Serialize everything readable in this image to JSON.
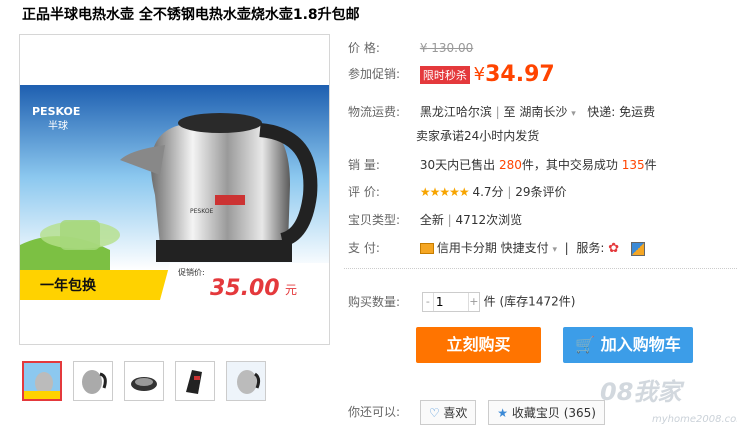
{
  "product": {
    "title": "正品半球电热水壶 全不锈钢电热水壶烧水壶1.8升包邮",
    "image": {
      "brand": "PESKOE",
      "brand_sub": "半球",
      "badge": "一年包换",
      "promo_label": "促销价:",
      "promo_price": "35.00",
      "promo_unit": "元",
      "kettle_label": "PESKOE"
    }
  },
  "price": {
    "label": "价      格:",
    "original": "¥ 130.00",
    "promo_label": "参加促销:",
    "limited_tag": "限时秒杀",
    "currency": "¥",
    "current": "34.97"
  },
  "shipping": {
    "label": "物流运费:",
    "from": "黑龙江哈尔滨",
    "sep": "|",
    "to_prefix": "至",
    "to": "湖南长沙",
    "express": "快递: 免运费",
    "promise": "卖家承诺24小时内发货"
  },
  "sales": {
    "label": "销      量:",
    "prefix": "30天内已售出",
    "sold": "280",
    "unit": "件，其中交易成功",
    "success": "135",
    "unit2": "件"
  },
  "rating": {
    "label": "评      价:",
    "stars": "★★★★★",
    "score": "4.7分",
    "sep": "|",
    "reviews": "29条评价"
  },
  "type": {
    "label": "宝贝类型:",
    "value": "全新",
    "sep": "|",
    "views": "4712次浏览"
  },
  "payment": {
    "label": "支      付:",
    "credit": "信用卡分期",
    "quick": "快捷支付",
    "service_label": "服务:"
  },
  "quantity": {
    "label": "购买数量:",
    "minus": "-",
    "value": "1",
    "plus": "+",
    "unit": "件",
    "stock": "(库存1472件)"
  },
  "actions": {
    "buy": "立刻购买",
    "cart": "加入购物车",
    "also_label": "你还可以:",
    "like": "喜欢",
    "favorite": "收藏宝贝",
    "favorite_count": "(365)"
  },
  "watermark": {
    "main": "08我家",
    "sub": "myhome2008.com"
  }
}
